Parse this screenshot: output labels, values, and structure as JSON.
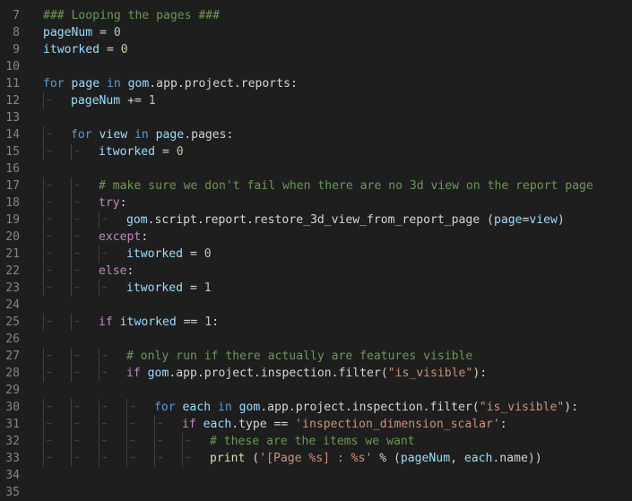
{
  "editor": {
    "colors": {
      "background": "#1e1e1e",
      "line_number": "#858585",
      "default": "#d4d4d4",
      "keyword": "#569cd6",
      "control": "#c586c0",
      "comment": "#6a9955",
      "string": "#ce9178",
      "number": "#b5cea8",
      "variable": "#9cdcfe",
      "function": "#dcdcaa",
      "whitespace_marker": "#5a5a5a"
    },
    "lines": [
      {
        "num": "7",
        "indent": 0,
        "tokens": [
          {
            "t": "### Looping the pages ###",
            "c": "comment"
          }
        ]
      },
      {
        "num": "8",
        "indent": 0,
        "tokens": [
          {
            "t": "pageNum",
            "c": "variable"
          },
          {
            "t": " = ",
            "c": "default"
          },
          {
            "t": "0",
            "c": "number"
          }
        ]
      },
      {
        "num": "9",
        "indent": 0,
        "tokens": [
          {
            "t": "itworked",
            "c": "variable"
          },
          {
            "t": " = ",
            "c": "default"
          },
          {
            "t": "0",
            "c": "number"
          }
        ]
      },
      {
        "num": "10",
        "indent": 0,
        "tokens": []
      },
      {
        "num": "11",
        "indent": 0,
        "tokens": [
          {
            "t": "for",
            "c": "keyword"
          },
          {
            "t": " ",
            "c": "default"
          },
          {
            "t": "page",
            "c": "variable"
          },
          {
            "t": " in ",
            "c": "keyword"
          },
          {
            "t": "gom",
            "c": "variable"
          },
          {
            "t": ".app.project.reports:",
            "c": "default"
          }
        ]
      },
      {
        "num": "12",
        "indent": 1,
        "tokens": [
          {
            "t": "pageNum",
            "c": "variable"
          },
          {
            "t": " += ",
            "c": "default"
          },
          {
            "t": "1",
            "c": "number"
          }
        ]
      },
      {
        "num": "13",
        "indent": 0,
        "tokens": []
      },
      {
        "num": "14",
        "indent": 1,
        "tokens": [
          {
            "t": "for",
            "c": "keyword"
          },
          {
            "t": " ",
            "c": "default"
          },
          {
            "t": "view",
            "c": "variable"
          },
          {
            "t": " in ",
            "c": "keyword"
          },
          {
            "t": "page",
            "c": "variable"
          },
          {
            "t": ".pages:",
            "c": "default"
          }
        ]
      },
      {
        "num": "15",
        "indent": 2,
        "tokens": [
          {
            "t": "itworked",
            "c": "variable"
          },
          {
            "t": " = ",
            "c": "default"
          },
          {
            "t": "0",
            "c": "number"
          }
        ]
      },
      {
        "num": "16",
        "indent": 0,
        "tokens": []
      },
      {
        "num": "17",
        "indent": 2,
        "tokens": [
          {
            "t": "# make sure we don't fail when there are no 3d view on the report page",
            "c": "comment"
          }
        ]
      },
      {
        "num": "18",
        "indent": 2,
        "tokens": [
          {
            "t": "try",
            "c": "control"
          },
          {
            "t": ":",
            "c": "default"
          }
        ]
      },
      {
        "num": "19",
        "indent": 3,
        "tokens": [
          {
            "t": "gom",
            "c": "variable"
          },
          {
            "t": ".script.report.restore_3d_view_from_report_page (",
            "c": "default"
          },
          {
            "t": "page",
            "c": "variable"
          },
          {
            "t": "=",
            "c": "default"
          },
          {
            "t": "view",
            "c": "variable"
          },
          {
            "t": ")",
            "c": "default"
          }
        ]
      },
      {
        "num": "20",
        "indent": 2,
        "tokens": [
          {
            "t": "except",
            "c": "control"
          },
          {
            "t": ":",
            "c": "default"
          }
        ]
      },
      {
        "num": "21",
        "indent": 3,
        "tokens": [
          {
            "t": "itworked",
            "c": "variable"
          },
          {
            "t": " = ",
            "c": "default"
          },
          {
            "t": "0",
            "c": "number"
          }
        ]
      },
      {
        "num": "22",
        "indent": 2,
        "tokens": [
          {
            "t": "else",
            "c": "control"
          },
          {
            "t": ":",
            "c": "default"
          }
        ]
      },
      {
        "num": "23",
        "indent": 3,
        "tokens": [
          {
            "t": "itworked",
            "c": "variable"
          },
          {
            "t": " = ",
            "c": "default"
          },
          {
            "t": "1",
            "c": "number"
          }
        ]
      },
      {
        "num": "24",
        "indent": 0,
        "tokens": []
      },
      {
        "num": "25",
        "indent": 2,
        "tokens": [
          {
            "t": "if",
            "c": "control"
          },
          {
            "t": " ",
            "c": "default"
          },
          {
            "t": "itworked",
            "c": "variable"
          },
          {
            "t": " == ",
            "c": "default"
          },
          {
            "t": "1",
            "c": "number"
          },
          {
            "t": ":",
            "c": "default"
          }
        ]
      },
      {
        "num": "26",
        "indent": 0,
        "tokens": []
      },
      {
        "num": "27",
        "indent": 3,
        "tokens": [
          {
            "t": "# only run if there actually are features visible",
            "c": "comment"
          }
        ]
      },
      {
        "num": "28",
        "indent": 3,
        "tokens": [
          {
            "t": "if",
            "c": "control"
          },
          {
            "t": " ",
            "c": "default"
          },
          {
            "t": "gom",
            "c": "variable"
          },
          {
            "t": ".app.project.inspection.filter(",
            "c": "default"
          },
          {
            "t": "\"is_visible\"",
            "c": "string"
          },
          {
            "t": "):",
            "c": "default"
          }
        ]
      },
      {
        "num": "29",
        "indent": 0,
        "tokens": []
      },
      {
        "num": "30",
        "indent": 4,
        "tokens": [
          {
            "t": "for",
            "c": "keyword"
          },
          {
            "t": " ",
            "c": "default"
          },
          {
            "t": "each",
            "c": "variable"
          },
          {
            "t": " in ",
            "c": "keyword"
          },
          {
            "t": "gom",
            "c": "variable"
          },
          {
            "t": ".app.project.inspection.filter(",
            "c": "default"
          },
          {
            "t": "\"is_visible\"",
            "c": "string"
          },
          {
            "t": "):",
            "c": "default"
          }
        ]
      },
      {
        "num": "31",
        "indent": 5,
        "tokens": [
          {
            "t": "if",
            "c": "control"
          },
          {
            "t": " ",
            "c": "default"
          },
          {
            "t": "each",
            "c": "variable"
          },
          {
            "t": ".type == ",
            "c": "default"
          },
          {
            "t": "'inspection_dimension_scalar'",
            "c": "string"
          },
          {
            "t": ":",
            "c": "default"
          }
        ]
      },
      {
        "num": "32",
        "indent": 6,
        "tokens": [
          {
            "t": "# these are the items we want",
            "c": "comment"
          }
        ]
      },
      {
        "num": "33",
        "indent": 6,
        "tokens": [
          {
            "t": "print",
            "c": "function"
          },
          {
            "t": " (",
            "c": "default"
          },
          {
            "t": "'[Page %s] : %s'",
            "c": "string"
          },
          {
            "t": " % (",
            "c": "default"
          },
          {
            "t": "pageNum",
            "c": "variable"
          },
          {
            "t": ", ",
            "c": "default"
          },
          {
            "t": "each",
            "c": "variable"
          },
          {
            "t": ".name))",
            "c": "default"
          }
        ]
      },
      {
        "num": "34",
        "indent": 0,
        "tokens": []
      },
      {
        "num": "35",
        "indent": 0,
        "tokens": []
      }
    ]
  }
}
